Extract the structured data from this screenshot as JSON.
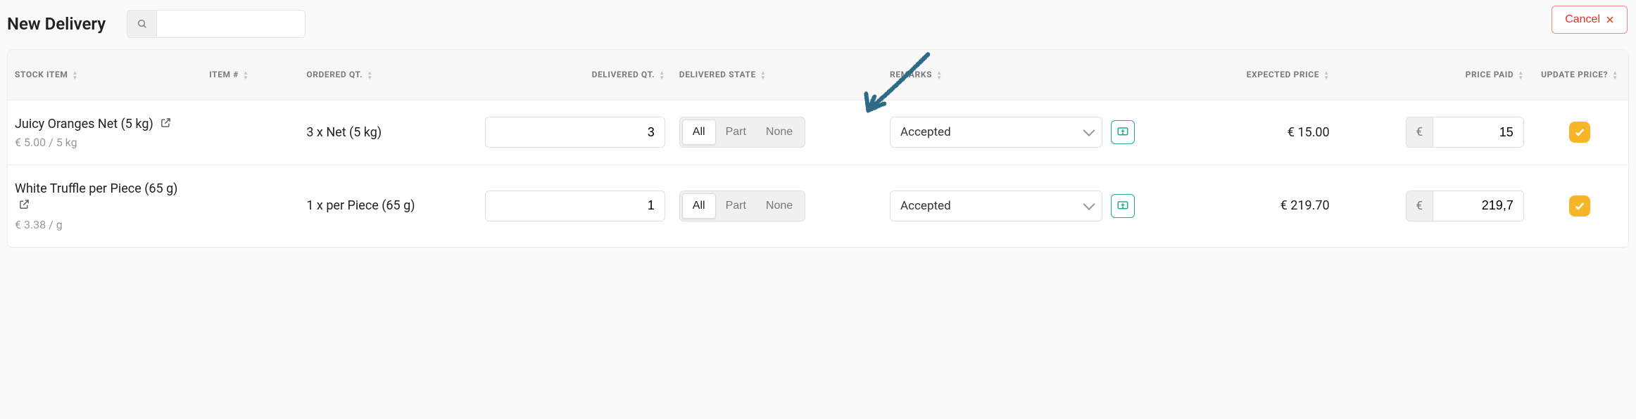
{
  "header": {
    "title": "New Delivery",
    "search_placeholder": "",
    "cancel_label": "Cancel"
  },
  "table": {
    "columns": {
      "stock_item": "STOCK ITEM",
      "item_no": "ITEM #",
      "ordered_qt": "ORDERED QT.",
      "delivered_qt": "DELIVERED QT.",
      "delivered_state": "DELIVERED STATE",
      "remarks": "REMARKS",
      "expected_price": "EXPECTED PRICE",
      "price_paid": "PRICE PAID",
      "update_price": "UPDATE PRICE?"
    },
    "state_options": {
      "all": "All",
      "part": "Part",
      "none": "None"
    },
    "currency_symbol": "€",
    "rows": [
      {
        "name": "Juicy Oranges Net (5 kg)",
        "sub": "€ 5.00 / 5 kg",
        "item_no": "",
        "ordered_qt": "3 x Net (5 kg)",
        "delivered_qt": "3",
        "state": "All",
        "remarks_selected": "Accepted",
        "expected_price": "€ 15.00",
        "price_paid": "15",
        "update_price": true
      },
      {
        "name": "White Truffle per Piece (65 g)",
        "sub": "€ 3.38 / g",
        "item_no": "",
        "ordered_qt": "1 x per Piece (65 g)",
        "delivered_qt": "1",
        "state": "All",
        "remarks_selected": "Accepted",
        "expected_price": "€ 219.70",
        "price_paid": "219,7",
        "update_price": true
      }
    ]
  }
}
